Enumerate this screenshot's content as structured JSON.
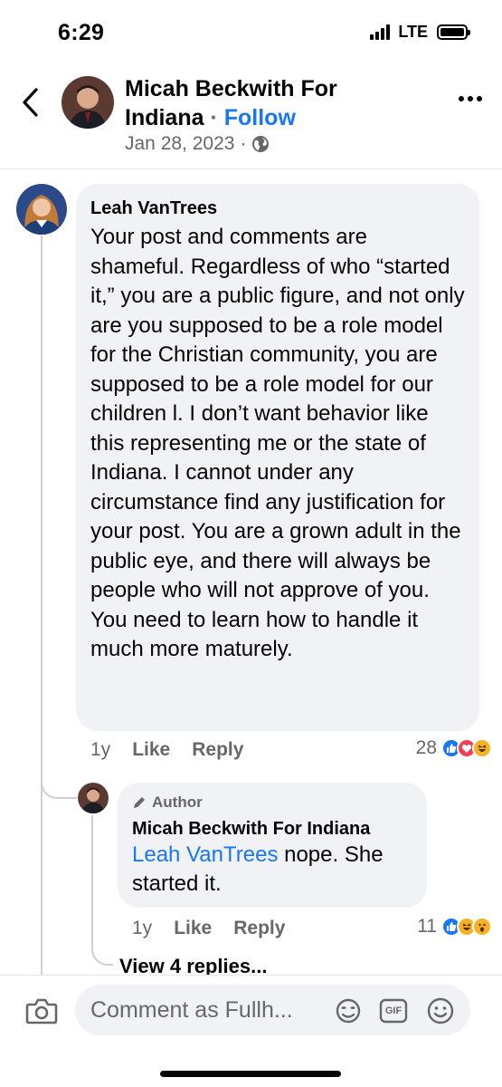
{
  "status_bar": {
    "time": "6:29",
    "network": "LTE"
  },
  "post_header": {
    "page_name_line1": "Micah Beckwith For",
    "page_name_line2": "Indiana",
    "separator": "·",
    "follow_label": "Follow",
    "date": "Jan 28, 2023",
    "audience_separator": "·",
    "audience_icon": "globe-icon",
    "back_icon": "chevron-left-icon",
    "more_icon": "more-horizontal-icon"
  },
  "comments": [
    {
      "author": "Leah VanTrees",
      "text": "Your post and comments are shameful. Regardless of who “started it,” you are a public figure, and not only are you supposed to be a role model for the Christian community, you are supposed to be a role model for our children l. I don’t want behavior like this representing me or the state of Indiana.  I cannot under any circumstance find any justification for your post.  You are a grown adult in the public eye, and there will always be people who will not approve of you. You need to learn how to handle it much more maturely.",
      "time": "1y",
      "like_label": "Like",
      "reply_label": "Reply",
      "reaction_count": "28",
      "reactions": [
        "like",
        "love",
        "haha"
      ]
    }
  ],
  "reply": {
    "badge": "Author",
    "badge_icon": "pencil-icon",
    "author": "Micah Beckwith For Indiana",
    "mention": "Leah VanTrees",
    "text": " nope. She started it.",
    "time": "1y",
    "like_label": "Like",
    "reply_label": "Reply",
    "reaction_count": "11",
    "reactions": [
      "like",
      "haha",
      "wow"
    ]
  },
  "view_replies_label": "View 4 replies...",
  "composer": {
    "placeholder": "Comment as Fullh...",
    "icons": [
      "camera-icon",
      "avatar-sticker-icon",
      "gif-icon",
      "emoji-icon"
    ],
    "gif_label": "GIF"
  },
  "colors": {
    "accent": "#1877f2",
    "secondary_text": "#65676b",
    "bubble": "#f0f2f5",
    "love": "#f33e58",
    "haha": "#f7b125"
  }
}
